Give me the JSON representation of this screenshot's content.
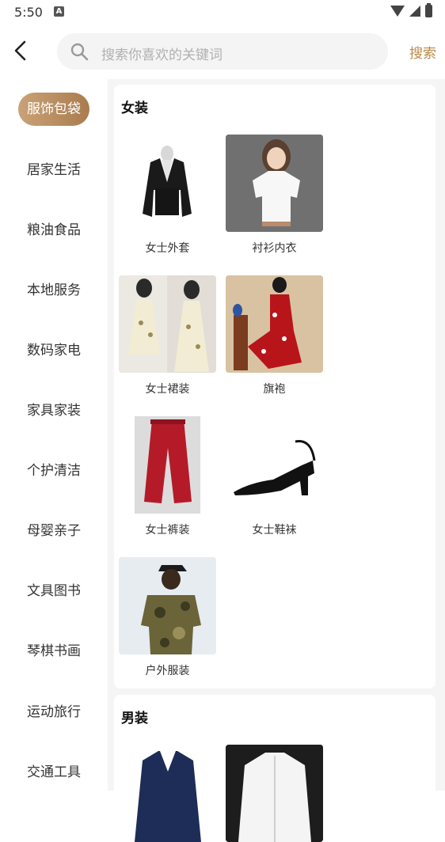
{
  "status_bar": {
    "time": "5:50",
    "notification_icon": "A"
  },
  "search": {
    "placeholder": "搜索你喜欢的关键词",
    "button_label": "搜索"
  },
  "sidebar": {
    "items": [
      "服饰包袋",
      "居家生活",
      "粮油食品",
      "本地服务",
      "数码家电",
      "家具家装",
      "个护清洁",
      "母婴亲子",
      "文具图书",
      "琴棋书画",
      "运动旅行",
      "交通工具"
    ],
    "active_index": 0
  },
  "sections": [
    {
      "title": "女装",
      "items": [
        "女士外套",
        "衬衫内衣",
        "女士裙装",
        "旗袍",
        "女士裤装",
        "女士鞋袜",
        "户外服装"
      ]
    },
    {
      "title": "男装",
      "items": []
    }
  ],
  "colors": {
    "accent": "#b78a49",
    "active_gradient_start": "#c9a277",
    "active_gradient_end": "#a97c4e"
  }
}
